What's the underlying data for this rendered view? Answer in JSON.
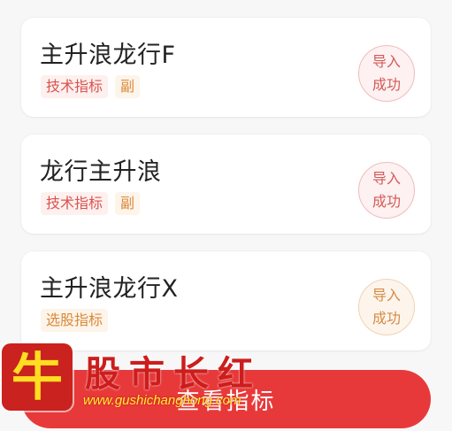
{
  "indicators": [
    {
      "name": "主升浪龙行F",
      "tags": [
        {
          "label": "技术指标",
          "tone": "red"
        },
        {
          "label": "副",
          "tone": "orange"
        }
      ],
      "status": {
        "line1": "导入",
        "line2": "成功",
        "tone": "red"
      }
    },
    {
      "name": "龙行主升浪",
      "tags": [
        {
          "label": "技术指标",
          "tone": "red"
        },
        {
          "label": "副",
          "tone": "orange"
        }
      ],
      "status": {
        "line1": "导入",
        "line2": "成功",
        "tone": "red"
      }
    },
    {
      "name": "主升浪龙行X",
      "tags": [
        {
          "label": "选股指标",
          "tone": "orange"
        }
      ],
      "status": {
        "line1": "导入",
        "line2": "成功",
        "tone": "orange"
      }
    }
  ],
  "bottom_button": {
    "label": "查看指标"
  },
  "watermark": {
    "logo_char": "牛",
    "site_name": "股市长红",
    "url": "www.gushichanghong.com"
  },
  "colors": {
    "accent_red": "#e8393a",
    "tag_red": "#d9534f",
    "tag_orange": "#d98a3a",
    "background": "#f7f7f8"
  }
}
